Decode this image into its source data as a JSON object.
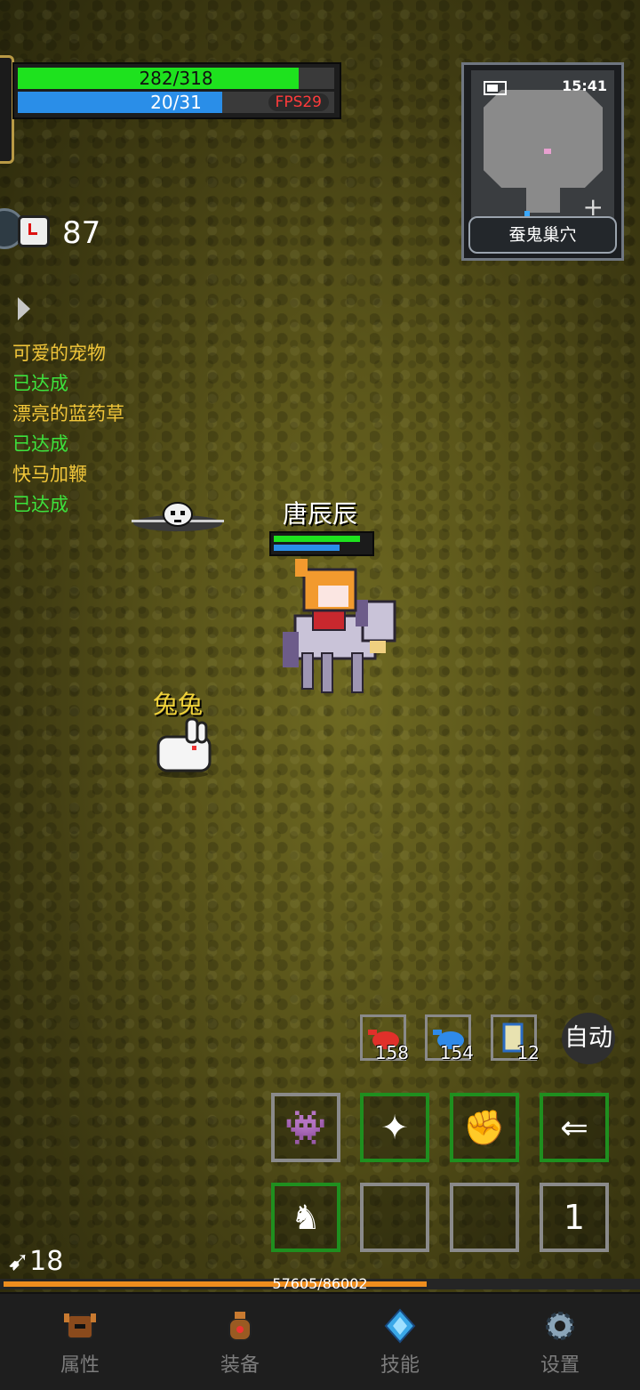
{
  "status": {
    "hp_text": "282/318",
    "hp_fraction": 0.887,
    "mp_text": "20/31",
    "mp_fraction": 0.645,
    "fps": "FPS29"
  },
  "minimap": {
    "time": "15:41",
    "location": "蚕鬼巢穴"
  },
  "timer": {
    "value": "87"
  },
  "quests": [
    {
      "title": "可爱的宠物",
      "status": "已达成"
    },
    {
      "title": "漂亮的蓝药草",
      "status": "已达成"
    },
    {
      "title": "快马加鞭",
      "status": "已达成"
    }
  ],
  "player": {
    "name": "唐辰辰",
    "hp_fraction": 0.88,
    "mp_fraction": 0.68
  },
  "pet": {
    "name": "兔兔"
  },
  "consumables": [
    {
      "icon": "red-potion-icon",
      "count": "158"
    },
    {
      "icon": "blue-potion-icon",
      "count": "154"
    },
    {
      "icon": "scroll-icon",
      "count": "12"
    }
  ],
  "auto_label": "自动",
  "skill_page": "1",
  "level": "18",
  "xp": {
    "text": "57605/86002",
    "fraction": 0.669
  },
  "nav": [
    {
      "icon": "helmet-icon",
      "label": "属性"
    },
    {
      "icon": "bag-icon",
      "label": "装备"
    },
    {
      "icon": "crystal-icon",
      "label": "技能"
    },
    {
      "icon": "gear-icon",
      "label": "设置"
    }
  ],
  "colors": {
    "hp": "#1ee21e",
    "mp": "#2a8ee8",
    "quest_title": "#f0c53a",
    "quest_done": "#3de23d",
    "xp": "#ee8d1e"
  }
}
